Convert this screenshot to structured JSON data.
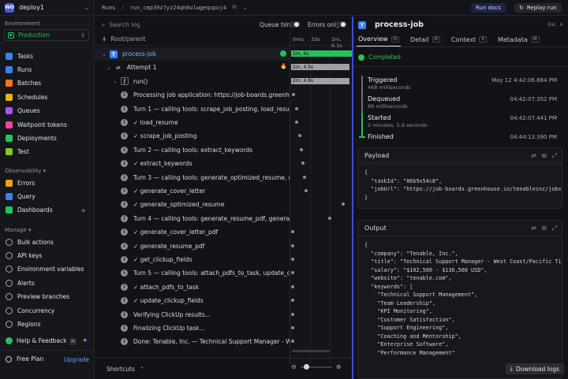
{
  "sidebar": {
    "project": "deploy1",
    "environment_label": "Environment",
    "environment_value": "Production",
    "nav": [
      {
        "label": "Tasks",
        "icon": "tasks-icon",
        "color": "#3b82f6"
      },
      {
        "label": "Runs",
        "icon": "runs-icon",
        "color": "#3b82f6"
      },
      {
        "label": "Batches",
        "icon": "batches-icon",
        "color": "#f97316"
      },
      {
        "label": "Schedules",
        "icon": "schedules-icon",
        "color": "#eab308"
      },
      {
        "label": "Queues",
        "icon": "queues-icon",
        "color": "#a855f7"
      },
      {
        "label": "Waitpoint tokens",
        "icon": "waitpoint-icon",
        "color": "#ec4899"
      },
      {
        "label": "Deployments",
        "icon": "deployments-icon",
        "color": "#22c55e"
      },
      {
        "label": "Test",
        "icon": "test-icon",
        "color": "#84cc16"
      }
    ],
    "observability_label": "Observability",
    "observability": [
      {
        "label": "Errors",
        "icon": "errors-icon",
        "color": "#f59e0b"
      },
      {
        "label": "Query",
        "icon": "query-icon",
        "color": "#3b82f6"
      },
      {
        "label": "Dashboards",
        "icon": "dashboards-icon",
        "color": "#22c55e"
      }
    ],
    "manage_label": "Manage",
    "manage": [
      {
        "label": "Bulk actions",
        "icon": "bulk-actions-icon"
      },
      {
        "label": "API keys",
        "icon": "api-keys-icon"
      },
      {
        "label": "Environment variables",
        "icon": "env-vars-icon"
      },
      {
        "label": "Alerts",
        "icon": "alerts-icon"
      },
      {
        "label": "Preview branches",
        "icon": "branches-icon"
      },
      {
        "label": "Concurrency",
        "icon": "concurrency-icon"
      },
      {
        "label": "Regions",
        "icon": "regions-icon"
      }
    ],
    "help": "Help & Feedback",
    "help_kbd": "H",
    "plan": "Free Plan",
    "upgrade": "Upgrade"
  },
  "topbar": {
    "crumb": "Runs",
    "run_id": "run_cmp39z7yz24qh0ulwgeqxpoj4",
    "run_docs": "Run docs",
    "replay": "Replay run"
  },
  "tree": {
    "search_placeholder": "Search log",
    "queue_time": "Queue time",
    "errors_only": "Errors only",
    "header": "Root/parent",
    "timeline_ticks": [
      "0ms",
      "33s",
      "1m, 6.1s"
    ],
    "rows": [
      {
        "label": "process-job",
        "type": "task"
      },
      {
        "label": "Attempt 1",
        "type": "attempt"
      },
      {
        "label": "run()",
        "type": "fn"
      },
      {
        "label": "Processing job application: https://job-boards.greenhouse.io/tenableinc/jobs/",
        "type": "log"
      },
      {
        "label": "Turn 1 — calling tools: scrape_job_posting, load_resume",
        "type": "log"
      },
      {
        "label": "✓ load_resume",
        "type": "log"
      },
      {
        "label": "✓ scrape_job_posting",
        "type": "log"
      },
      {
        "label": "Turn 2 — calling tools: extract_keywords",
        "type": "log"
      },
      {
        "label": "✓ extract_keywords",
        "type": "log"
      },
      {
        "label": "Turn 3 — calling tools: generate_optimized_resume, generate_cover_letter",
        "type": "log"
      },
      {
        "label": "✓ generate_cover_letter",
        "type": "log"
      },
      {
        "label": "✓ generate_optimized_resume",
        "type": "log"
      },
      {
        "label": "Turn 4 — calling tools: generate_resume_pdf, generate_cover_letter_pdf",
        "type": "log"
      },
      {
        "label": "✓ generate_cover_letter_pdf",
        "type": "log"
      },
      {
        "label": "✓ generate_resume_pdf",
        "type": "log"
      },
      {
        "label": "✓ get_clickup_fields",
        "type": "log"
      },
      {
        "label": "Turn 5 — calling tools: attach_pdfs_to_task, update_clickup_fields",
        "type": "log"
      },
      {
        "label": "✓ attach_pdfs_to_task",
        "type": "log"
      },
      {
        "label": "✓ update_clickup_fields",
        "type": "log"
      },
      {
        "label": "Verifying ClickUp results...",
        "type": "log"
      },
      {
        "label": "Finalizing ClickUp task...",
        "type": "log"
      },
      {
        "label": "Done: Tenable, Inc. — Technical Support Manager - West Coast/Pacific Time",
        "type": "log"
      }
    ],
    "bars": [
      {
        "label": "2m, 6s",
        "color": "#28bf5c"
      },
      {
        "label": "2m, 4.9s",
        "color": "#9ea1a8"
      },
      {
        "label": "2m, 4.8s",
        "color": "#9ea1a8"
      }
    ],
    "shortcuts": "Shortcuts"
  },
  "detail": {
    "title": "process-job",
    "esc": "Esc",
    "tabs": [
      {
        "label": "Overview",
        "key": "O"
      },
      {
        "label": "Detail",
        "key": "D"
      },
      {
        "label": "Context",
        "key": "X"
      },
      {
        "label": "Metadata",
        "key": "M"
      }
    ],
    "status": "Completed",
    "events": [
      {
        "title": "Triggered",
        "sub": "468 milliseconds",
        "time": "May 12 4:42:06.884 PM"
      },
      {
        "title": "Dequeued",
        "sub": "89 milliseconds",
        "time": "04:42:07.352 PM"
      },
      {
        "title": "Started",
        "sub": "2 minutes, 5.9 seconds",
        "time": "04:42:07.441 PM"
      },
      {
        "title": "Finished",
        "sub": "",
        "time": "04:44:13.390 PM"
      }
    ],
    "payload_title": "Payload",
    "payload_lines": [
      "{",
      "  \"taskId\": \"86b9x54c8\",",
      "  \"jobUrl\": \"https://job-boards.greenhouse.io/tenableinc/jobs/!",
      "}"
    ],
    "output_title": "Output",
    "output_lines": [
      "{",
      "  \"company\": \"Tenable, Inc.\",",
      "  \"title\": \"Technical Support Manager - West Coast/Pacific Time",
      "  \"salary\": \"$102,500 - $136,500 USD\",",
      "  \"website\": \"tenable.com\",",
      "  \"keywords\": [",
      "    \"Technical Support Management\",",
      "    \"Team Leadership\",",
      "    \"KPI Monitoring\",",
      "    \"Customer Satisfaction\",",
      "    \"Support Engineering\",",
      "    \"Coaching and Mentorship\",",
      "    \"Enterprise Software\",",
      "    \"Performance Management\""
    ],
    "download": "Download logs"
  }
}
